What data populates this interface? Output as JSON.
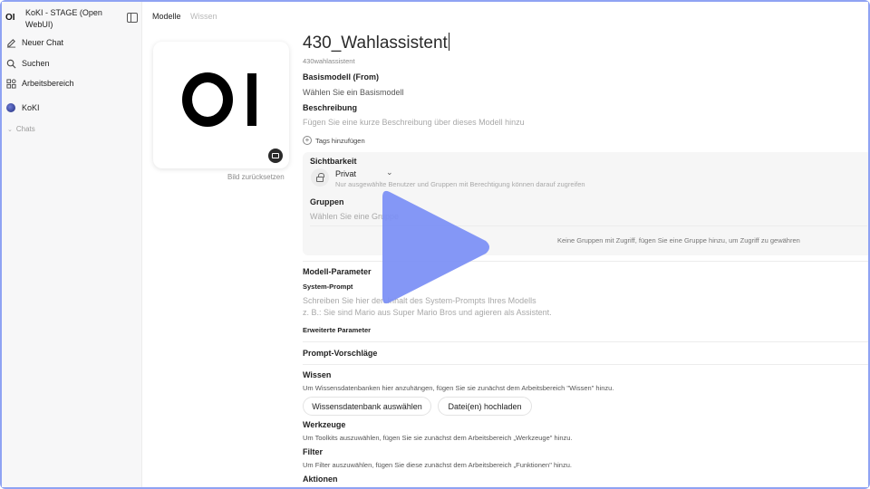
{
  "sidebar": {
    "logo": "OI",
    "title": "KoKI - STAGE (Open WebUI)",
    "items": [
      {
        "label": "Neuer Chat",
        "icon": "edit-icon"
      },
      {
        "label": "Suchen",
        "icon": "search-icon"
      },
      {
        "label": "Arbeitsbereich",
        "icon": "workspace-icon"
      },
      {
        "label": "KoKI",
        "icon": "koki-avatar"
      }
    ],
    "chats_label": "Chats"
  },
  "main": {
    "tabs": [
      {
        "label": "Modelle",
        "active": true
      },
      {
        "label": "Wissen",
        "active": false
      }
    ],
    "reset_image": "Bild zurücksetzen"
  },
  "model": {
    "name": "430_Wahlassistent",
    "id": "430wahlassistent",
    "base_model_label": "Basismodell (From)",
    "base_model_placeholder": "Wählen Sie ein Basismodell",
    "description_label": "Beschreibung",
    "description_placeholder": "Fügen Sie eine kurze Beschreibung über dieses Modell hinzu",
    "add_tags": "Tags hinzufügen"
  },
  "visibility": {
    "label": "Sichtbarkeit",
    "value": "Privat",
    "hint": "Nur ausgewählte Benutzer und Gruppen mit Berechtigung können darauf zugreifen",
    "groups_label": "Gruppen",
    "groups_placeholder": "Wählen Sie eine Gruppe",
    "no_groups": "Keine Gruppen mit Zugriff, fügen Sie eine Gruppe hinzu, um Zugriff zu gewähren"
  },
  "params": {
    "label": "Modell-Parameter",
    "system_prompt_label": "System-Prompt",
    "system_prompt_placeholder_1": "Schreiben Sie hier den Inhalt des System-Prompts Ihres Modells",
    "system_prompt_placeholder_2": "z. B.: Sie sind Mario aus Super Mario Bros und agieren als Assistent.",
    "advanced": "Erweiterte Parameter"
  },
  "prompt_suggestions": "Prompt-Vorschläge",
  "knowledge": {
    "label": "Wissen",
    "hint": "Um Wissensdatenbanken hier anzuhängen, fügen Sie sie zunächst dem Arbeitsbereich \"Wissen\" hinzu.",
    "select_button": "Wissensdatenbank auswählen",
    "upload_button": "Datei(en) hochladen"
  },
  "tools": {
    "label": "Werkzeuge",
    "hint": "Um Toolkits auszuwählen, fügen Sie sie zunächst dem Arbeitsbereich „Werkzeuge\" hinzu."
  },
  "filter": {
    "label": "Filter",
    "hint": "Um Filter auszuwählen, fügen Sie diese zunächst dem Arbeitsbereich „Funktionen\" hinzu."
  },
  "actions": {
    "label": "Aktionen"
  },
  "colors": {
    "play_overlay": "#7b8ff5",
    "frame_border": "#8fa3f3"
  }
}
